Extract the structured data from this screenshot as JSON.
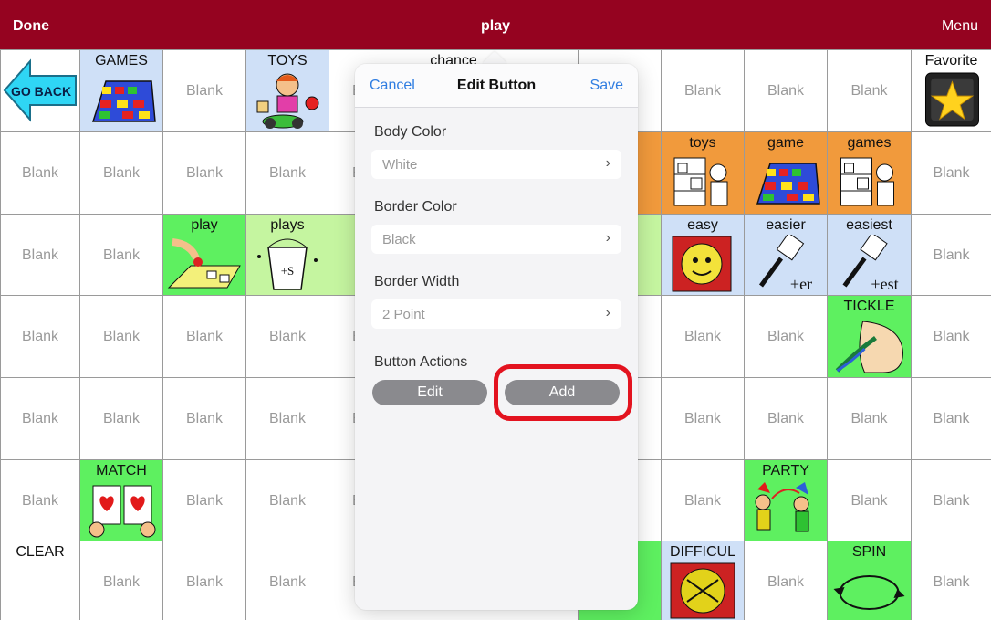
{
  "topbar": {
    "left": "Done",
    "title": "play",
    "right": "Menu"
  },
  "grid": {
    "blank_label": "Blank",
    "labels": {
      "go_back": "GO BACK",
      "games": "GAMES",
      "toys": "TOYS",
      "chance": "chance",
      "favorite": "Favorite",
      "toys_lower": "toys",
      "game": "game",
      "games_lower": "games",
      "play": "play",
      "plays": "plays",
      "easy": "easy",
      "easier": "easier",
      "easiest": "easiest",
      "tickle": "TICKLE",
      "match": "MATCH",
      "party": "PARTY",
      "clear": "CLEAR",
      "difficult": "DIFFICUL",
      "spin": "SPIN",
      "plays_s": "+S",
      "er": "+er",
      "est": "+est"
    }
  },
  "colors": {
    "topbar": "#950320",
    "blue_cell": "#cfe0f7",
    "green_cell": "#5ef060",
    "orange_cell": "#f19a3c",
    "accent": "#2f7de1",
    "highlight": "#e3131f"
  },
  "popover": {
    "cancel": "Cancel",
    "title": "Edit Button",
    "save": "Save",
    "body_color_label": "Body Color",
    "body_color_value": "White",
    "border_color_label": "Border Color",
    "border_color_value": "Black",
    "border_width_label": "Border Width",
    "border_width_value": "2 Point",
    "actions_label": "Button Actions",
    "edit": "Edit",
    "add": "Add"
  }
}
